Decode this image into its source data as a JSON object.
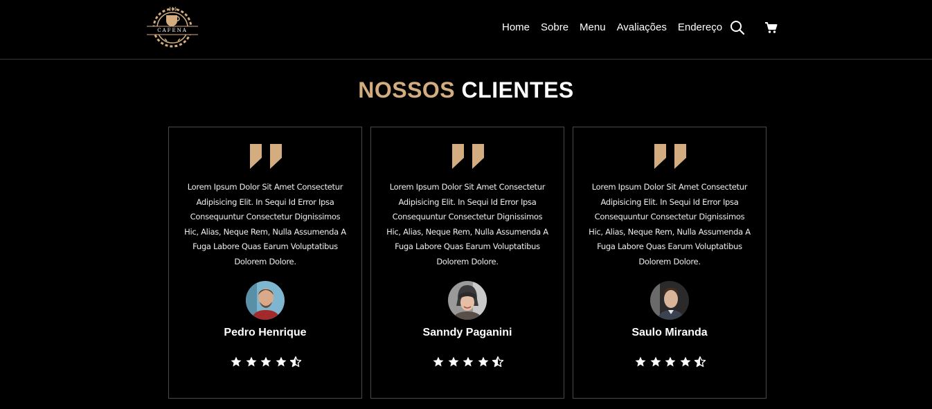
{
  "header": {
    "logo_text": "CAFENA",
    "nav": [
      "Home",
      "Sobre",
      "Menu",
      "Avaliações",
      "Endereço"
    ],
    "icons": {
      "search": "search-icon",
      "cart": "cart-icon"
    }
  },
  "section": {
    "title_accent": "NOSSOS",
    "title_main": "CLIENTES"
  },
  "colors": {
    "accent": "#d3ad7f",
    "background": "#000000",
    "border": "#4a4a4a"
  },
  "testimonials": [
    {
      "text": "Lorem Ipsum Dolor Sit Amet Consectetur Adipisicing Elit. In Sequi Id Error Ipsa Consequuntur Consectetur Dignissimos Hic, Alias, Neque Rem, Nulla Assumenda A Fuga Labore Quas Earum Voluptatibus Dolorem Dolore.",
      "name": "Pedro Henrique",
      "rating": 4.5
    },
    {
      "text": "Lorem Ipsum Dolor Sit Amet Consectetur Adipisicing Elit. In Sequi Id Error Ipsa Consequuntur Consectetur Dignissimos Hic, Alias, Neque Rem, Nulla Assumenda A Fuga Labore Quas Earum Voluptatibus Dolorem Dolore.",
      "name": "Sanndy Paganini",
      "rating": 4.5
    },
    {
      "text": "Lorem Ipsum Dolor Sit Amet Consectetur Adipisicing Elit. In Sequi Id Error Ipsa Consequuntur Consectetur Dignissimos Hic, Alias, Neque Rem, Nulla Assumenda A Fuga Labore Quas Earum Voluptatibus Dolorem Dolore.",
      "name": "Saulo Miranda",
      "rating": 4.5
    }
  ]
}
